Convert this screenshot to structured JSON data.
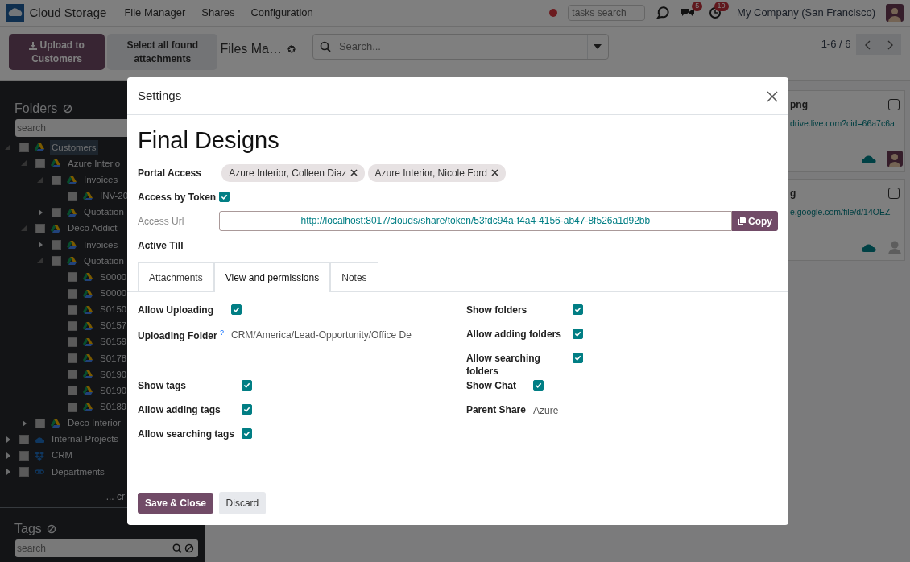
{
  "app": {
    "name": "Cloud Storage",
    "menu": [
      "File Manager",
      "Shares",
      "Configuration"
    ]
  },
  "systray": {
    "search_placeholder": "tasks search",
    "messages_count": "5",
    "activities_count": "10",
    "company": "My Company (San Francisco)"
  },
  "control_panel": {
    "upload_button": "Upload to Customers",
    "select_button": "Select all found attachments",
    "title": "Files Ma…",
    "search_placeholder": "Search...",
    "pager": "1-6 / 6"
  },
  "sidebar": {
    "folders_title": "Folders",
    "search_placeholder": "search",
    "more": "... cr",
    "tags_title": "Tags",
    "tags_search_placeholder": "search",
    "tree": [
      {
        "label": "Customers",
        "kind": "drive",
        "checked": false,
        "selected": true,
        "expanded": true,
        "children": [
          {
            "label": "Azure Interio",
            "kind": "drive",
            "checked": false,
            "selected": false,
            "expanded": true,
            "children": [
              {
                "label": "Invoices",
                "kind": "drive",
                "checked": false,
                "selected": false,
                "expanded": true,
                "children": [
                  {
                    "label": "INV-20",
                    "kind": "drive",
                    "checked": false,
                    "selected": false
                  }
                ]
              },
              {
                "label": "Quotation",
                "kind": "drive",
                "checked": false,
                "selected": false,
                "expanded": false
              }
            ]
          },
          {
            "label": "Deco Addict",
            "kind": "drive",
            "checked": false,
            "selected": false,
            "expanded": true,
            "children": [
              {
                "label": "Invoices",
                "kind": "drive",
                "checked": false,
                "selected": false,
                "expanded": false
              },
              {
                "label": "Quotation",
                "kind": "drive",
                "checked": false,
                "selected": false,
                "expanded": true,
                "children": [
                  {
                    "label": "S0000",
                    "kind": "drive",
                    "checked": false,
                    "selected": false
                  },
                  {
                    "label": "S0000",
                    "kind": "drive",
                    "checked": false,
                    "selected": false
                  },
                  {
                    "label": "S0150",
                    "kind": "drive",
                    "checked": false,
                    "selected": false
                  },
                  {
                    "label": "S0157",
                    "kind": "drive",
                    "checked": false,
                    "selected": false
                  },
                  {
                    "label": "S0159",
                    "kind": "drive",
                    "checked": false,
                    "selected": false
                  },
                  {
                    "label": "S0178",
                    "kind": "drive",
                    "checked": false,
                    "selected": false
                  },
                  {
                    "label": "S0190",
                    "kind": "drive",
                    "checked": false,
                    "selected": false
                  },
                  {
                    "label": "S0190",
                    "kind": "drive",
                    "checked": false,
                    "selected": false
                  },
                  {
                    "label": "S0189",
                    "kind": "drive",
                    "checked": false,
                    "selected": false
                  }
                ]
              }
            ]
          },
          {
            "label": "Deco Interior",
            "kind": "drive",
            "checked": false,
            "selected": false,
            "expanded": false
          }
        ]
      },
      {
        "label": "Internal Projects",
        "kind": "cloud",
        "checked": false,
        "selected": false,
        "expanded": false
      },
      {
        "label": "CRM",
        "kind": "dropbox",
        "checked": false,
        "selected": false,
        "expanded": false
      },
      {
        "label": "Departments",
        "kind": "chain",
        "checked": false,
        "selected": false,
        "expanded": false
      }
    ]
  },
  "cards": [
    {
      "name": "png",
      "url": "drive.live.com?cid=66a7c6a",
      "checked": false,
      "kind": "person"
    },
    {
      "name": "g",
      "url": "e.google.com/file/d/14OEZ",
      "checked": false,
      "kind": "placeholder"
    }
  ],
  "modal": {
    "title": "Settings",
    "record_name": "Final Designs",
    "portal_access": {
      "label": "Portal Access",
      "tags": [
        "Azure Interior, Colleen Diaz",
        "Azure Interior, Nicole Ford"
      ]
    },
    "access_by_token": {
      "label": "Access by Token",
      "checked": true
    },
    "access_url": {
      "label": "Access Url",
      "value": "http://localhost:8017/clouds/share/token/53fdc94a-f4a4-4156-ab47-8f526a1d92bb",
      "copy_button": "Copy"
    },
    "active_till": {
      "label": "Active Till"
    },
    "tabs": [
      {
        "label": "Attachments",
        "selected": false
      },
      {
        "label": "View and permissions",
        "selected": true
      },
      {
        "label": "Notes",
        "selected": false
      }
    ],
    "groups": [
      {
        "left": [
          {
            "kind": "checkbox",
            "label": "Allow Uploading",
            "checked": true
          },
          {
            "kind": "text",
            "label": "Uploading Folder",
            "help": "?",
            "value": "CRM/America/Lead-Opportunity/Office De"
          }
        ],
        "right": [
          {
            "kind": "checkbox",
            "label": "Show folders",
            "checked": true
          },
          {
            "kind": "checkbox",
            "label": "Allow adding folders",
            "checked": true
          },
          {
            "kind": "checkbox",
            "label": "Allow searching folders",
            "checked": true
          }
        ]
      },
      {
        "left": [
          {
            "kind": "checkbox",
            "label": "Show tags",
            "checked": true
          },
          {
            "kind": "checkbox",
            "label": "Allow adding tags",
            "checked": true
          },
          {
            "kind": "checkbox",
            "label": "Allow searching tags",
            "checked": true
          }
        ],
        "right": [
          {
            "kind": "checkbox",
            "label": "Show Chat",
            "checked": true
          },
          {
            "kind": "text",
            "label": "Parent Share",
            "value": "Azure"
          }
        ]
      }
    ],
    "buttons": [
      {
        "label": "Save & Close",
        "kind": "primary"
      },
      {
        "label": "Discard",
        "kind": "secondary"
      }
    ]
  }
}
